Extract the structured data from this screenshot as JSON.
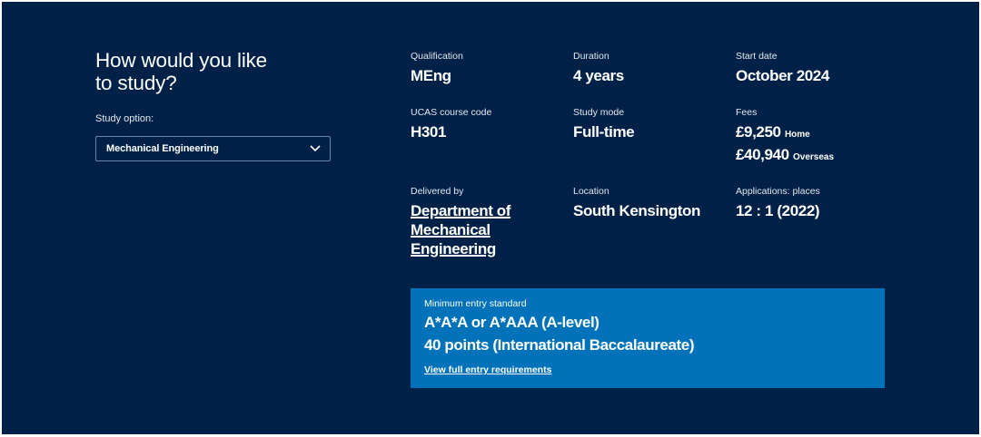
{
  "study": {
    "heading": "How would you like to study?",
    "option_label": "Study option:",
    "selected_option": "Mechanical Engineering",
    "dropdown_icon": "chevron-down-icon"
  },
  "facts": [
    {
      "label": "Qualification",
      "value": "MEng"
    },
    {
      "label": "Duration",
      "value": "4 years"
    },
    {
      "label": "Start date",
      "value": "October 2024"
    },
    {
      "label": "UCAS course code",
      "value": "H301"
    },
    {
      "label": "Study mode",
      "value": "Full-time"
    },
    {
      "label": "Delivered by",
      "value": "Department of Mechanical Engineering"
    },
    {
      "label": "Location",
      "value": "South Kensington"
    },
    {
      "label": "Applications: places",
      "value": "12 : 1 (2022)"
    }
  ],
  "fees": {
    "label": "Fees",
    "home_amount": "£9,250",
    "home_suffix": "Home",
    "overseas_amount": "£40,940",
    "overseas_suffix": "Overseas"
  },
  "entry": {
    "label": "Minimum entry standard",
    "alevel": "A*A*A or A*AAA (A-level)",
    "ib": "40 points (International Baccalaureate)",
    "link": "View full entry requirements"
  },
  "colors": {
    "panel_background": "#002147",
    "entry_box_background": "#0072b9",
    "text": "#ffffff"
  }
}
